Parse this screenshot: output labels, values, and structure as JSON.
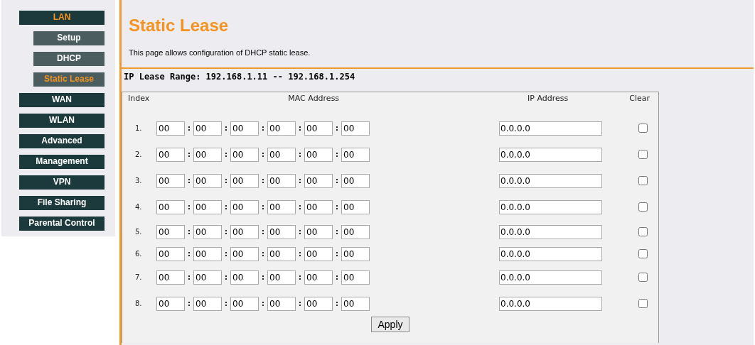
{
  "sidebar": {
    "items": [
      {
        "label": "LAN",
        "selected": true,
        "children": [
          {
            "label": "Setup",
            "selected": false
          },
          {
            "label": "DHCP",
            "selected": false
          },
          {
            "label": "Static Lease",
            "selected": true
          }
        ]
      },
      {
        "label": "WAN",
        "selected": false
      },
      {
        "label": "WLAN",
        "selected": false
      },
      {
        "label": "Advanced",
        "selected": false
      },
      {
        "label": "Management",
        "selected": false
      },
      {
        "label": "VPN",
        "selected": false
      },
      {
        "label": "File Sharing",
        "selected": false
      },
      {
        "label": "Parental Control",
        "selected": false
      }
    ]
  },
  "page": {
    "title": "Static Lease",
    "description": "This page allows configuration of DHCP static lease.",
    "lease_range": "IP Lease Range: 192.168.1.11 -- 192.168.1.254"
  },
  "table": {
    "columns": [
      "Index",
      "MAC Address",
      "IP Address",
      "Clear"
    ],
    "separator": ":",
    "rows": [
      {
        "index": "1.",
        "mac": [
          "00",
          "00",
          "00",
          "00",
          "00",
          "00"
        ],
        "ip": "0.0.0.0",
        "clear": false
      },
      {
        "index": "2.",
        "mac": [
          "00",
          "00",
          "00",
          "00",
          "00",
          "00"
        ],
        "ip": "0.0.0.0",
        "clear": false
      },
      {
        "index": "3.",
        "mac": [
          "00",
          "00",
          "00",
          "00",
          "00",
          "00"
        ],
        "ip": "0.0.0.0",
        "clear": false
      },
      {
        "index": "4.",
        "mac": [
          "00",
          "00",
          "00",
          "00",
          "00",
          "00"
        ],
        "ip": "0.0.0.0",
        "clear": false
      },
      {
        "index": "5.",
        "mac": [
          "00",
          "00",
          "00",
          "00",
          "00",
          "00"
        ],
        "ip": "0.0.0.0",
        "clear": false
      },
      {
        "index": "6.",
        "mac": [
          "00",
          "00",
          "00",
          "00",
          "00",
          "00"
        ],
        "ip": "0.0.0.0",
        "clear": false
      },
      {
        "index": "7.",
        "mac": [
          "00",
          "00",
          "00",
          "00",
          "00",
          "00"
        ],
        "ip": "0.0.0.0",
        "clear": false
      },
      {
        "index": "8.",
        "mac": [
          "00",
          "00",
          "00",
          "00",
          "00",
          "00"
        ],
        "ip": "0.0.0.0",
        "clear": false
      }
    ]
  },
  "apply_button": "Apply"
}
